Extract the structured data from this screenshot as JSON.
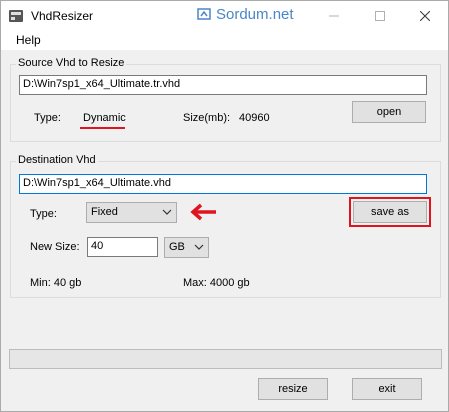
{
  "window": {
    "title": "VhdResizer",
    "watermark": "Sordum.net"
  },
  "menu": {
    "help": "Help"
  },
  "source": {
    "group_title": "Source Vhd to Resize",
    "path": "D:\\Win7sp1_x64_Ultimate.tr.vhd",
    "type_label": "Type:",
    "type_value": "Dynamic",
    "size_label": "Size(mb):",
    "size_value": "40960",
    "open_label": "open"
  },
  "destination": {
    "group_title": "Destination Vhd",
    "path": "D:\\Win7sp1_x64_Ultimate.vhd",
    "type_label": "Type:",
    "type_selected": "Fixed",
    "save_as_label": "save as",
    "new_size_label": "New Size:",
    "new_size_value": "40",
    "unit_selected": "GB",
    "min_text": "Min: 40 gb",
    "max_text": "Max: 4000 gb"
  },
  "progress": {
    "fraction": 0
  },
  "buttons": {
    "resize": "resize",
    "exit": "exit"
  },
  "colors": {
    "annotation": "#e0141e",
    "watermark": "#4a86c8",
    "focus_border": "#0078d7"
  },
  "icons": {
    "app": "app-icon",
    "minimize": "minimize-icon",
    "maximize": "maximize-icon",
    "close": "close-icon"
  }
}
